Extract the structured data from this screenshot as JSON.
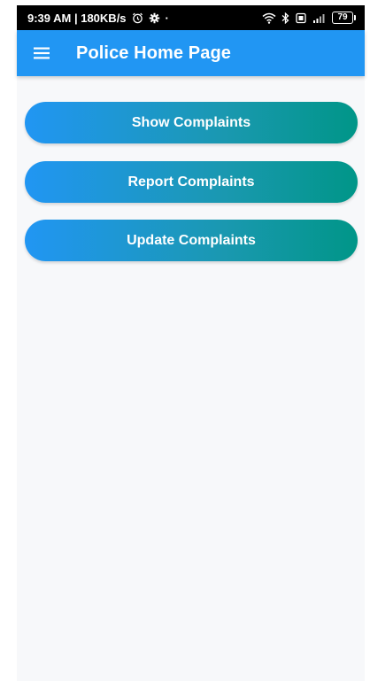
{
  "status_bar": {
    "time_speed": "9:39 AM | 180KB/s",
    "alarm_icon": "alarm-clock-icon",
    "settings_icon": "gear-icon",
    "dot": "·",
    "wifi_icon": "wifi-icon",
    "bluetooth_icon": "bluetooth-icon",
    "battery_level": "79"
  },
  "app_bar": {
    "menu_icon": "hamburger-menu-icon",
    "title": "Police Home Page",
    "color": "#2196f3"
  },
  "actions": [
    {
      "label": "Show Complaints"
    },
    {
      "label": "Report Complaints"
    },
    {
      "label": "Update Complaints"
    }
  ],
  "colors": {
    "gradient_start": "#2196f3",
    "gradient_end": "#009688",
    "background": "#f7f8fa"
  }
}
